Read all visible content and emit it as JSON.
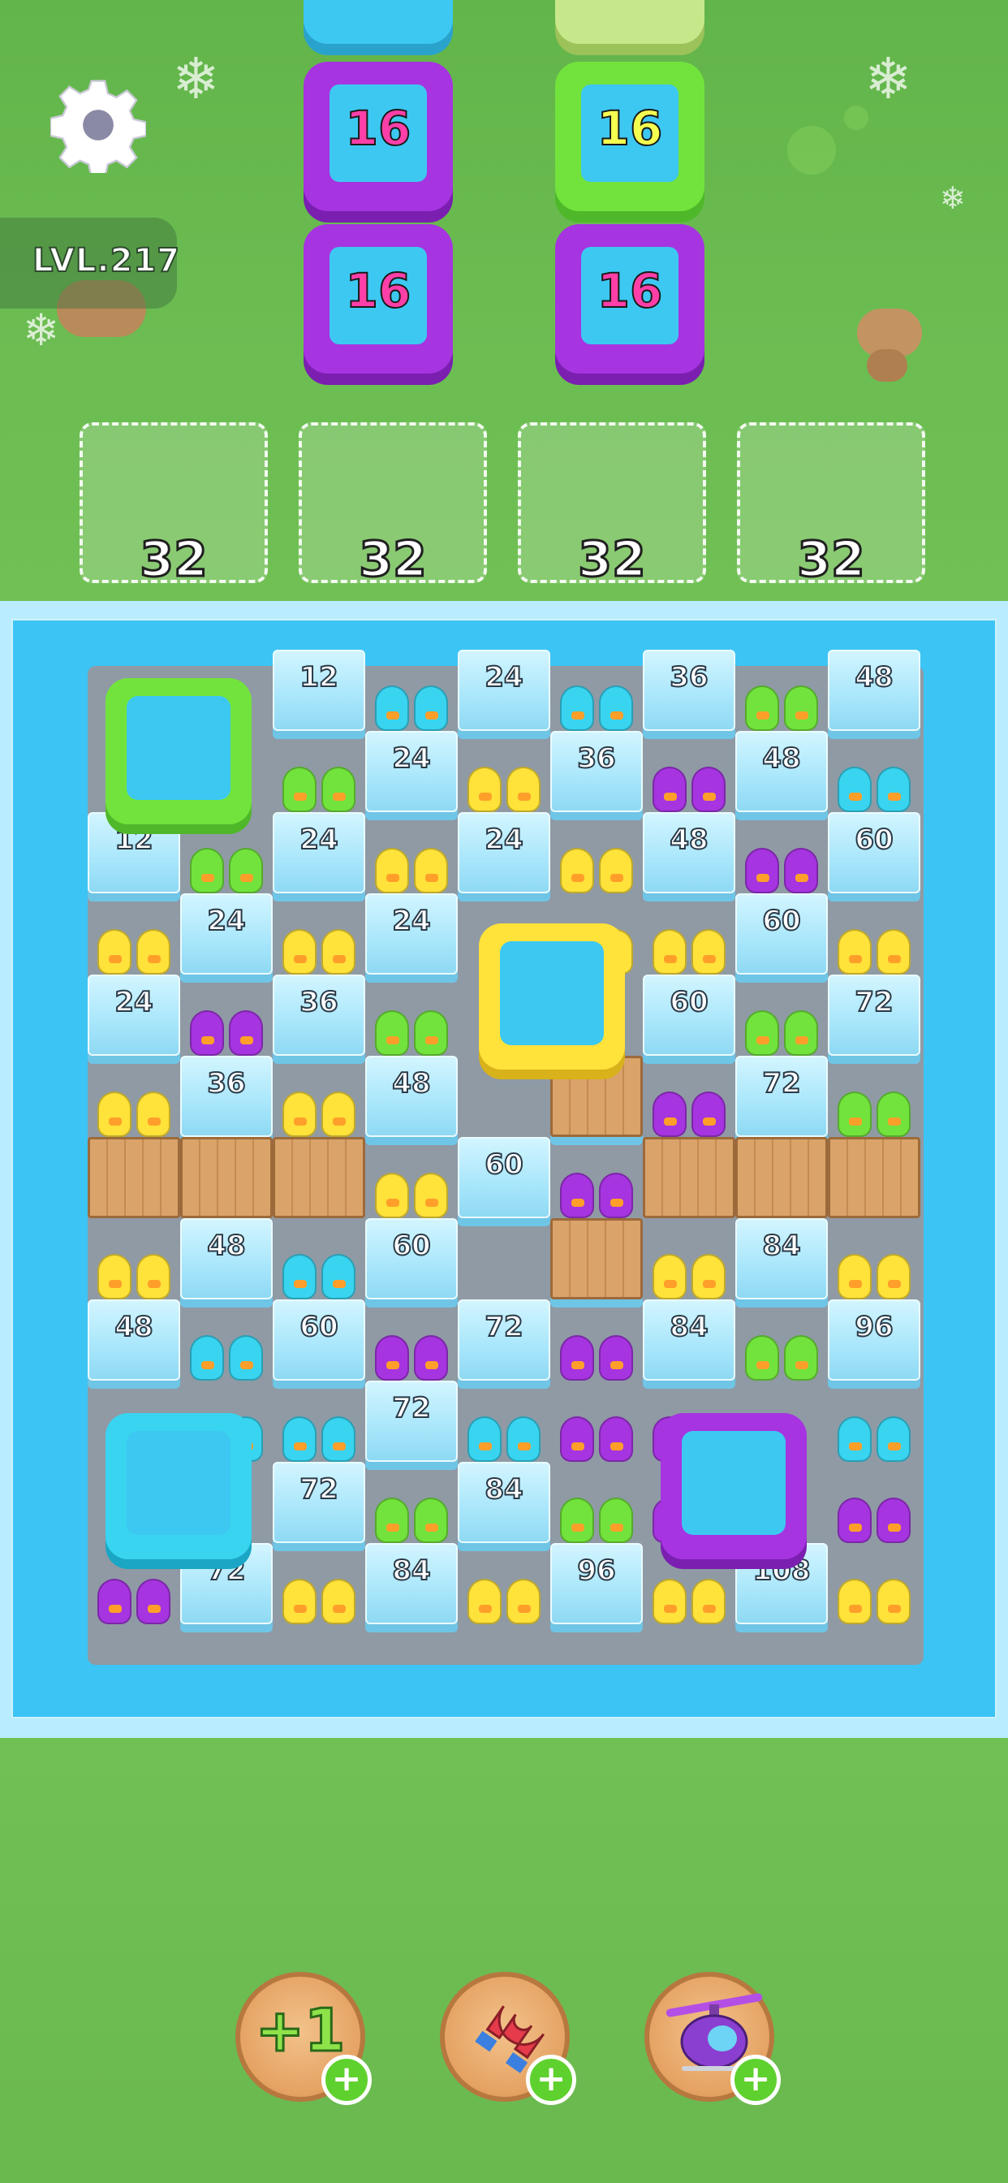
{
  "hud": {
    "level": "LVL.217"
  },
  "stacks": [
    {
      "value": "16",
      "color": "#a634e0"
    },
    {
      "value": "16",
      "color": "#a634e0"
    },
    {
      "value": "16",
      "color": "#72e33c"
    },
    {
      "value": "16",
      "color": "#a634e0"
    }
  ],
  "slots": [
    {
      "capacity": "32"
    },
    {
      "capacity": "32"
    },
    {
      "capacity": "32"
    },
    {
      "capacity": "32"
    }
  ],
  "ice_blocks": [
    "12",
    "24",
    "36",
    "48",
    "24",
    "36",
    "48",
    "12",
    "24",
    "24",
    "48",
    "60",
    "24",
    "24",
    "60",
    "24",
    "36",
    "60",
    "72",
    "36",
    "48",
    "60",
    "72",
    "60",
    "48",
    "60",
    "72",
    "84",
    "48",
    "60",
    "72",
    "84",
    "96",
    "72",
    "72",
    "84",
    "72",
    "84",
    "96",
    "108"
  ],
  "containers": [
    {
      "color": "green"
    },
    {
      "color": "yellow"
    },
    {
      "color": "cyan"
    },
    {
      "color": "purple"
    }
  ],
  "colors": {
    "green": "#72e33c",
    "yellow": "#ffe23a",
    "cyan": "#38d4f0",
    "purple": "#a634e0"
  },
  "boosters": [
    {
      "icon": "+1",
      "name": "extra-slot"
    },
    {
      "icon": "magnet-icon",
      "name": "magnet"
    },
    {
      "icon": "helicopter-icon",
      "name": "helicopter"
    }
  ],
  "booster_add": "+"
}
